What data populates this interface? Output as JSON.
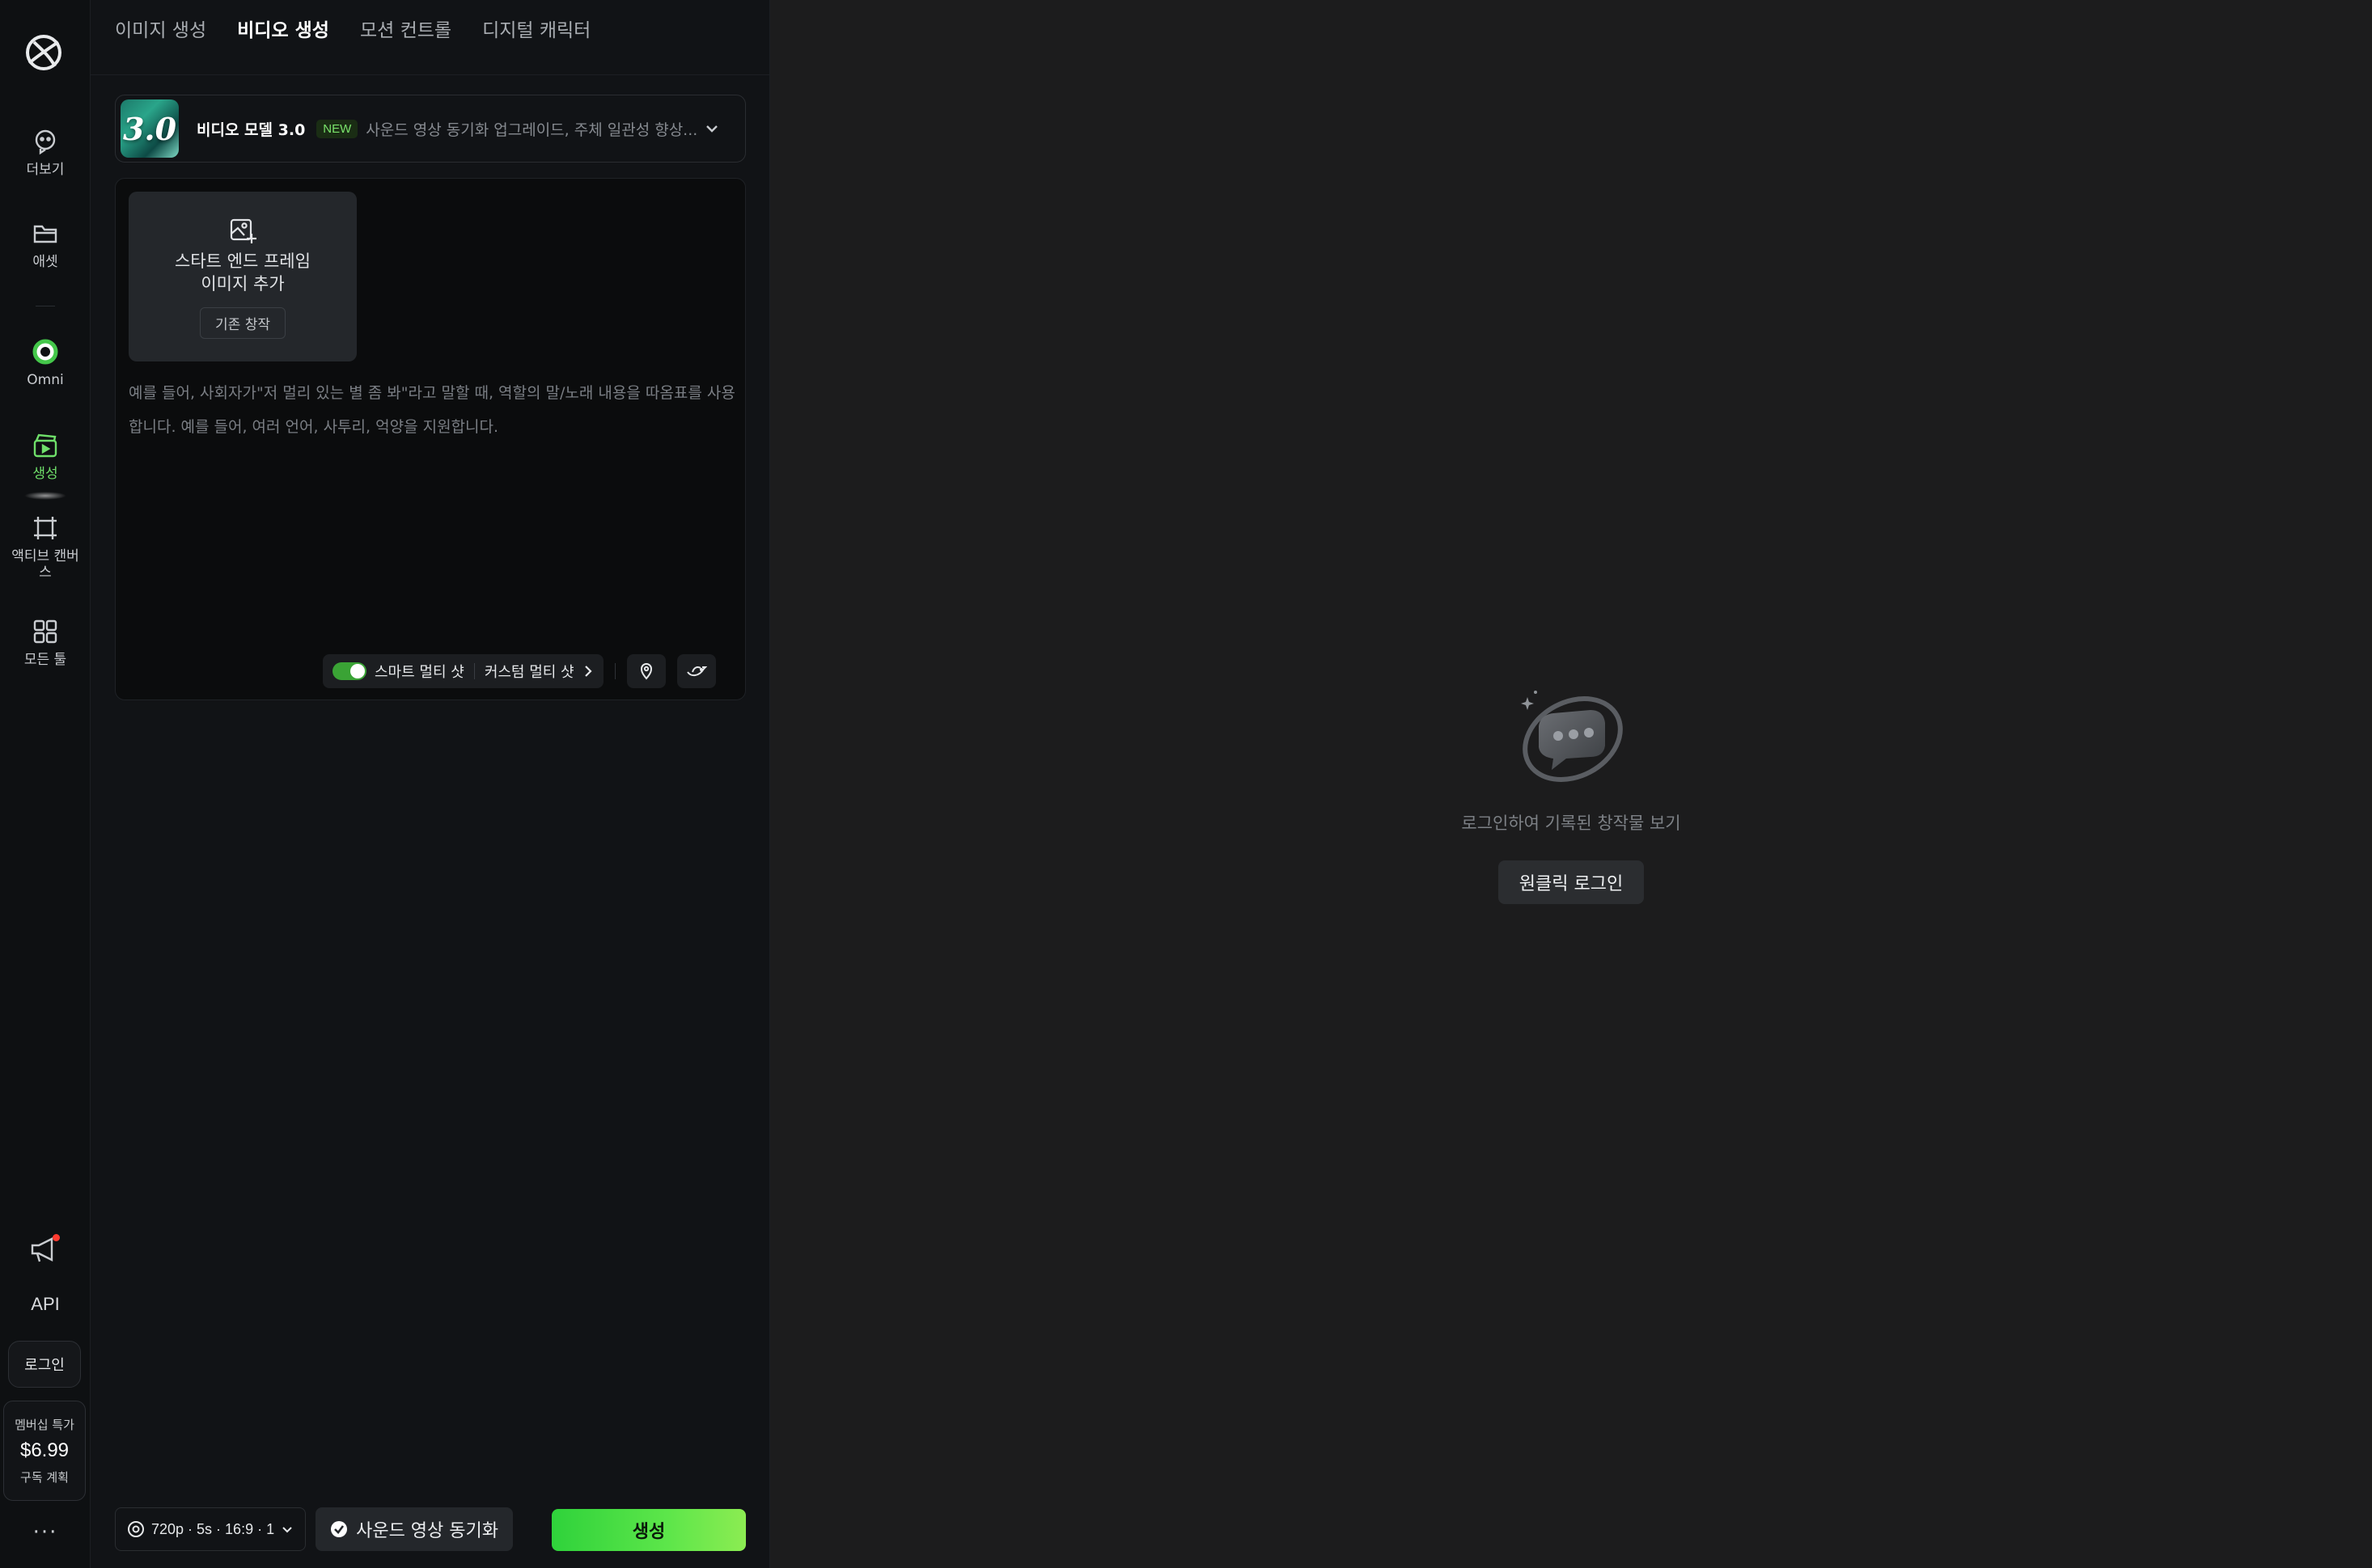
{
  "sidebar": {
    "items": [
      {
        "label": "더보기",
        "icon": "ai-bot-icon"
      },
      {
        "label": "애셋",
        "icon": "folder-icon"
      },
      {
        "label": "Omni",
        "icon": "omni-ring-icon"
      },
      {
        "label": "생성",
        "icon": "video-create-icon",
        "active": true
      },
      {
        "label": "액티브 캔버스",
        "icon": "canvas-frame-icon"
      },
      {
        "label": "모든 툴",
        "icon": "grid-icon"
      }
    ],
    "api_label": "API",
    "login_label": "로그인",
    "promo": {
      "title": "멤버십 특가",
      "price": "$6.99",
      "subtitle": "구독 계획"
    },
    "more_label": "···"
  },
  "tabs": [
    {
      "label": "이미지 생성",
      "active": false
    },
    {
      "label": "비디오 생성",
      "active": true
    },
    {
      "label": "모션 컨트롤",
      "active": false
    },
    {
      "label": "디지털 캐릭터",
      "active": false
    }
  ],
  "model": {
    "thumb_text": "3.0",
    "name": "비디오 모델 3.0",
    "badge": "NEW",
    "description": "사운드 영상 동기화 업그레이드, 주체 일관성 향상..."
  },
  "frame_card": {
    "label": "스타트 엔드 프레임 이미지 추가",
    "history_button": "기존 창작"
  },
  "prompt": {
    "placeholder": "예를 들어, 사회자가\"저 멀리 있는 별 좀 봐\"라고 말할 때, 역할의 말/노래 내용을 따옴표를 사용 합니다. 예를 들어, 여러 언어, 사투리, 억양을 지원합니다."
  },
  "prompt_tools": {
    "smart_multishot": "스마트 멀티 샷",
    "smart_multishot_enabled": true,
    "custom_multishot": "커스텀 멀티 샷"
  },
  "bottom": {
    "settings": "720p · 5s · 16:9 · 1",
    "sound_sync": "사운드 영상 동기화",
    "generate": "생성"
  },
  "canvas": {
    "empty_text": "로그인하여 기록된 창작물 보기",
    "login_button": "원클릭 로그인"
  },
  "colors": {
    "accent_green": "#5de64a",
    "background": "#111316",
    "canvas_bg": "#1c1c1d"
  }
}
